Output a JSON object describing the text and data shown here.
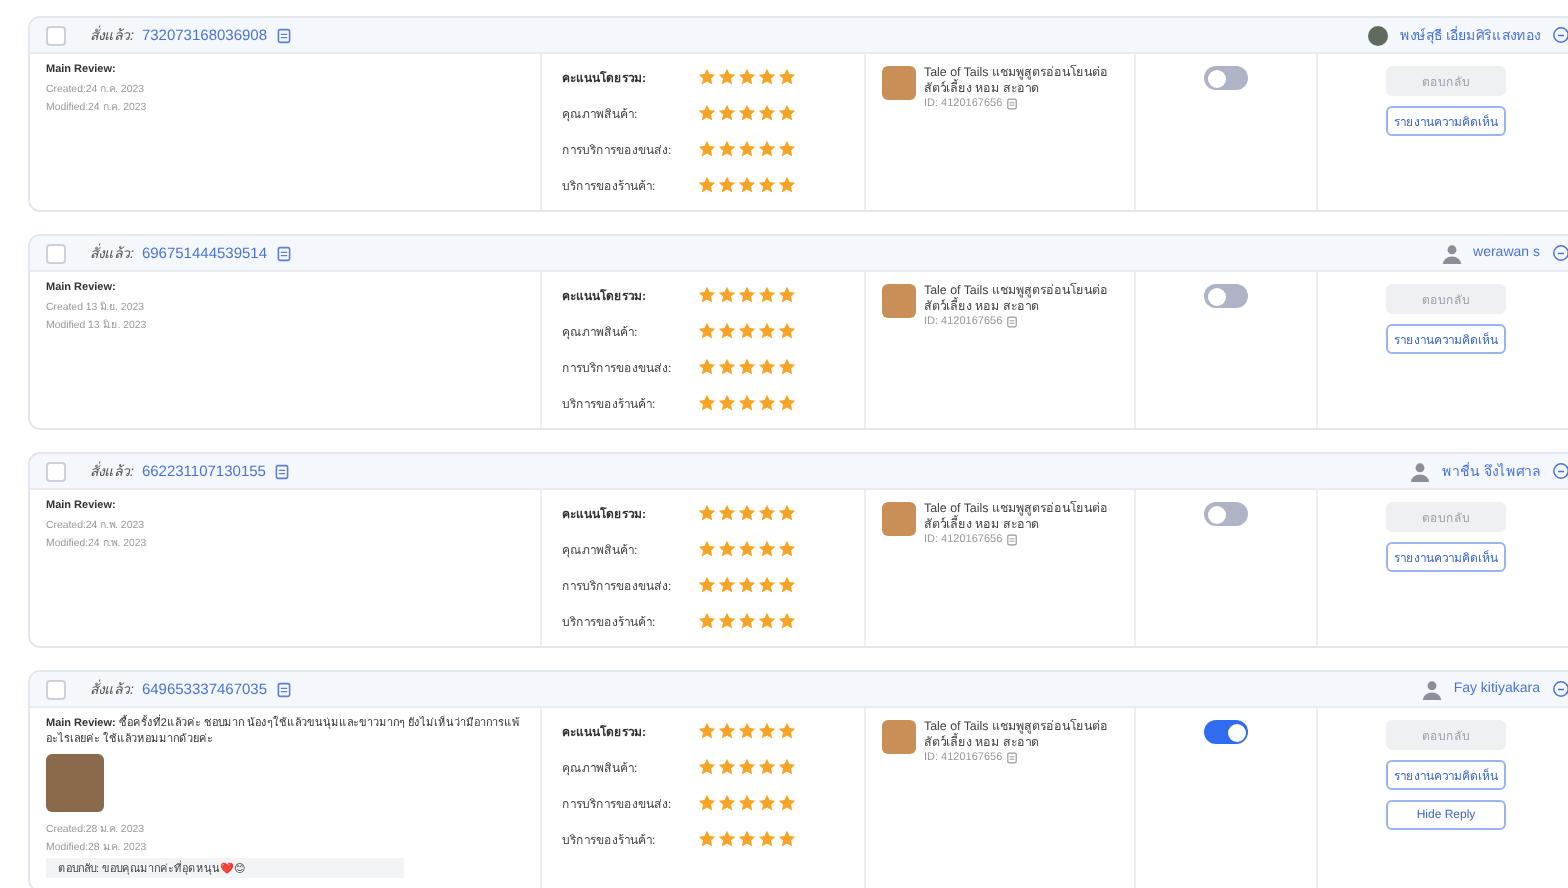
{
  "reviews": [
    {
      "checked": false,
      "order_label": "สั่งแล้ว:",
      "order_id": "732073168036908",
      "user": {
        "name": "พงษ์สุธี เอี่ยมศิริแสงทอง",
        "avatar_photo": true
      },
      "review_label": "Main Review:",
      "has_photo": false,
      "created": "Created:24 ก.ค. 2023",
      "modified": "Modified:24 ก.ค. 2023",
      "ratings": [
        {
          "label": "คะแนนโดยรวม:",
          "stars": 5
        },
        {
          "label": "คุณภาพสินค้า:",
          "stars": 5
        },
        {
          "label": "การบริการของขนส่ง:",
          "stars": 5
        },
        {
          "label": "บริการของร้านค้า:",
          "stars": 5
        }
      ],
      "product": {
        "name": "Tale of Tails แชมพูสูตรอ่อนโยนต่อสัตว์เลี้ยง หอม สะอาด",
        "id": "ID: 4120167656"
      },
      "visible_on": false,
      "buttons": [
        {
          "label": "ตอบกลับ",
          "disabled": true
        },
        {
          "label": "รายงานความคิดเห็น",
          "disabled": false
        }
      ]
    },
    {
      "checked": false,
      "order_label": "สั่งแล้ว:",
      "order_id": "696751444539514",
      "user": {
        "name": "werawan s",
        "avatar_photo": false
      },
      "review_label": "Main Review:",
      "has_photo": false,
      "created": "Created 13 มิ.ย. 2023",
      "modified": "Modified 13 มิ.ย. 2023",
      "ratings": [
        {
          "label": "คะแนนโดยรวม:",
          "stars": 5
        },
        {
          "label": "คุณภาพสินค้า:",
          "stars": 5
        },
        {
          "label": "การบริการของขนส่ง:",
          "stars": 5
        },
        {
          "label": "บริการของร้านค้า:",
          "stars": 5
        }
      ],
      "product": {
        "name": "Tale of Tails แชมพูสูตรอ่อนโยนต่อสัตว์เลี้ยง หอม สะอาด",
        "id": "ID: 4120167656"
      },
      "visible_on": false,
      "buttons": [
        {
          "label": "ตอบกลับ",
          "disabled": true
        },
        {
          "label": "รายงานความคิดเห็น",
          "disabled": false
        }
      ]
    },
    {
      "checked": false,
      "order_label": "สั่งแล้ว:",
      "order_id": "662231107130155",
      "user": {
        "name": "พาชื่น จึงไพศาล",
        "avatar_photo": false
      },
      "review_label": "Main Review:",
      "has_photo": false,
      "created": "Created:24 ก.พ. 2023",
      "modified": "Modified:24 ก.พ. 2023",
      "ratings": [
        {
          "label": "คะแนนโดยรวม:",
          "stars": 5
        },
        {
          "label": "คุณภาพสินค้า:",
          "stars": 5
        },
        {
          "label": "การบริการของขนส่ง:",
          "stars": 5
        },
        {
          "label": "บริการของร้านค้า:",
          "stars": 5
        }
      ],
      "product": {
        "name": "Tale of Tails แชมพูสูตรอ่อนโยนต่อสัตว์เลี้ยง หอม สะอาด",
        "id": "ID: 4120167656"
      },
      "visible_on": false,
      "buttons": [
        {
          "label": "ตอบกลับ",
          "disabled": true
        },
        {
          "label": "รายงานความคิดเห็น",
          "disabled": false
        }
      ]
    },
    {
      "checked": false,
      "order_label": "สั่งแล้ว:",
      "order_id": "649653337467035",
      "user": {
        "name": "Fay kitiyakara",
        "avatar_photo": false
      },
      "review_label": "Main Review:",
      "review_text": "ซื้อครั้งที่2แล้วค่ะ ชอบมาก น้องๆใช้แล้วขนนุ่มและขาวมากๆ ยังไม่เห็นว่ามีอาการแพ้อะไรเลยค่ะ ใช้แล้วหอมมากด้วยค่ะ",
      "has_photo": true,
      "created": "Created:28 ม.ค. 2023",
      "modified": "Modified:28 ม.ค. 2023",
      "reply": "ตอบกลับ: ขอบคุณมากค่ะที่อุดหนุน❤️😊",
      "ratings": [
        {
          "label": "คะแนนโดยรวม:",
          "stars": 5
        },
        {
          "label": "คุณภาพสินค้า:",
          "stars": 5
        },
        {
          "label": "การบริการของขนส่ง:",
          "stars": 5
        },
        {
          "label": "บริการของร้านค้า:",
          "stars": 5
        }
      ],
      "product": {
        "name": "Tale of Tails แชมพูสูตรอ่อนโยนต่อสัตว์เลี้ยง หอม สะอาด",
        "id": "ID: 4120167656"
      },
      "visible_on": true,
      "buttons": [
        {
          "label": "ตอบกลับ",
          "disabled": true
        },
        {
          "label": "รายงานความคิดเห็น",
          "disabled": false
        },
        {
          "label": "Hide Reply",
          "disabled": false
        }
      ]
    }
  ]
}
